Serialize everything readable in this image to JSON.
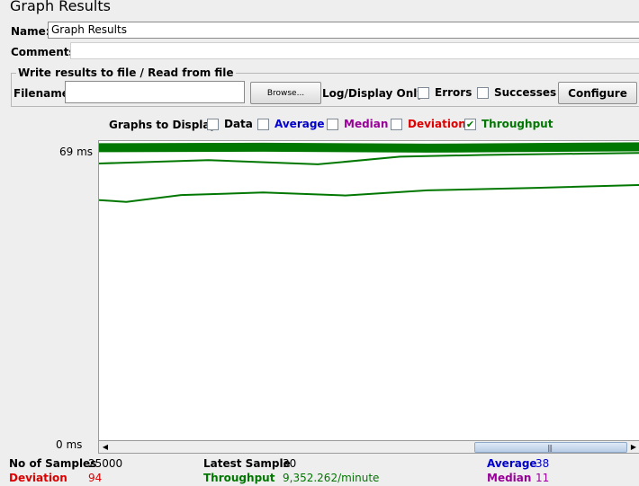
{
  "window": {
    "title": "Graph Results"
  },
  "form": {
    "name_label": "Name:",
    "name_value": "Graph Results",
    "comments_label": "Comments:",
    "comments_value": ""
  },
  "file_panel": {
    "legend": "Write results to file / Read from file",
    "filename_label": "Filename",
    "filename_value": "",
    "browse_label": "Browse...",
    "log_display_label": "Log/Display Only:",
    "errors_label": "Errors",
    "errors_checked": false,
    "successes_label": "Successes",
    "successes_checked": false,
    "configure_label": "Configure"
  },
  "graphs_to_display": {
    "label": "Graphs to Display",
    "options": [
      {
        "label": "Data",
        "checked": false,
        "color": "#000000"
      },
      {
        "label": "Average",
        "checked": false,
        "color": "#0000cc"
      },
      {
        "label": "Median",
        "checked": false,
        "color": "#990099"
      },
      {
        "label": "Deviation",
        "checked": false,
        "color": "#dd0000"
      },
      {
        "label": "Throughput",
        "checked": true,
        "color": "#007700"
      }
    ]
  },
  "chart_data": {
    "type": "line",
    "title": "",
    "xlabel": "",
    "ylabel": "",
    "y_ticks": [
      "69 ms",
      "0 ms"
    ],
    "ylim": [
      0,
      69
    ],
    "grid": false,
    "series": [
      {
        "color": "#007700",
        "x": [
          0,
          30,
          60,
          100
        ],
        "y": [
          68.5,
          68.6,
          68.4,
          68.7
        ]
      },
      {
        "color": "#007700",
        "x": [
          0,
          20,
          40,
          55,
          70,
          100
        ],
        "y": [
          64.8,
          65.6,
          64.6,
          66.4,
          66.8,
          67.3
        ]
      },
      {
        "color": "#007700",
        "x": [
          0,
          5,
          15,
          30,
          45,
          60,
          80,
          100
        ],
        "y": [
          56.2,
          55.8,
          57.4,
          58.0,
          57.3,
          58.5,
          59.1,
          59.8
        ]
      }
    ]
  },
  "stats": {
    "no_of_samples_label": "No of Samples",
    "no_of_samples_value": "25000",
    "latest_sample_label": "Latest Sample",
    "latest_sample_value": "30",
    "average_label": "Average",
    "average_value": "38",
    "deviation_label": "Deviation",
    "deviation_value": "94",
    "throughput_label": "Throughput",
    "throughput_value": "9,352.262/minute",
    "median_label": "Median",
    "median_value": "11"
  },
  "colors": {
    "average": "#0000cc",
    "median": "#990099",
    "deviation": "#dd0000",
    "throughput": "#007700"
  }
}
